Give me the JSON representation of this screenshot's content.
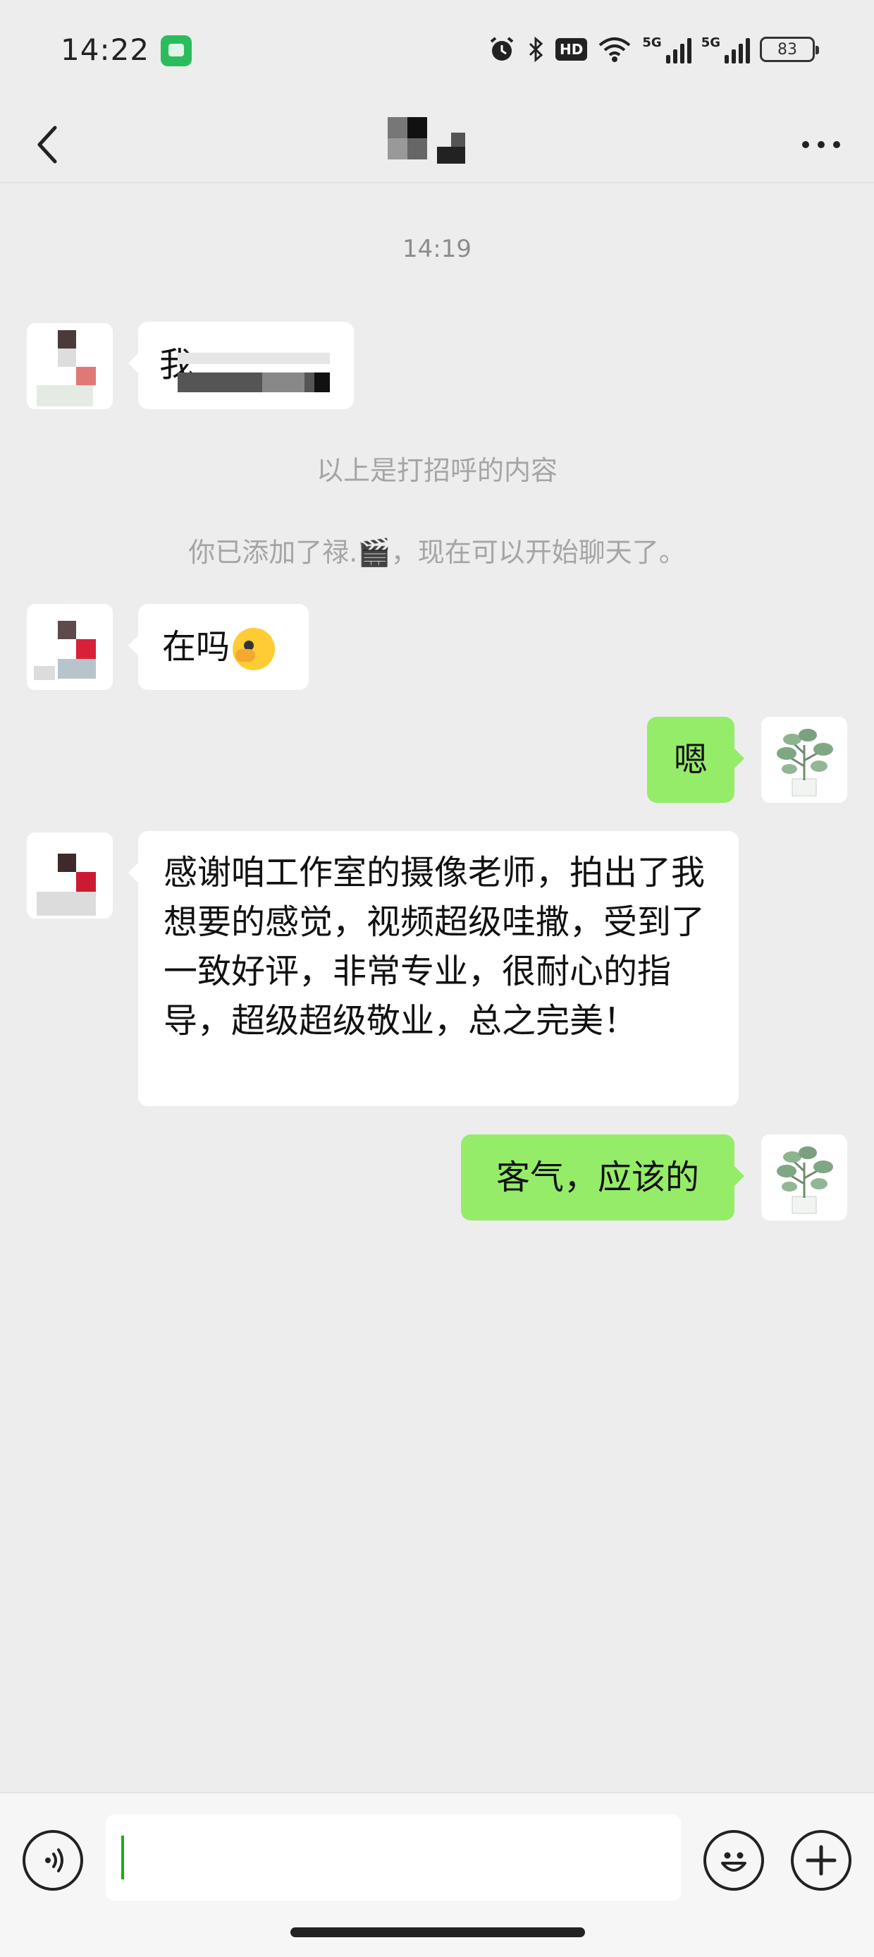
{
  "status_bar": {
    "time": "14:22",
    "notification_icon": "message-app-icon",
    "icons": [
      "alarm-icon",
      "bluetooth-icon",
      "hd-voice-icon",
      "wifi-icon",
      "signal-5g-icon",
      "signal-5g-icon",
      "battery-icon"
    ],
    "hd_label": "HD",
    "network_labels": [
      "5G",
      "5G"
    ],
    "battery": "83"
  },
  "nav": {
    "back_icon": "chevron-left-icon",
    "more_icon": "more-dots-icon"
  },
  "chat": {
    "timestamp": "14:19",
    "greeting_notice": "以上是打招呼的内容",
    "added_notice": "你已添加了禄.🎬，现在可以开始聊天了。",
    "messages": [
      {
        "from": "them",
        "text": "我"
      },
      {
        "from": "them",
        "text": "在吗",
        "emoji": "sly-face-emoji"
      },
      {
        "from": "me",
        "text": "嗯"
      },
      {
        "from": "them",
        "text": "感谢咱工作室的摄像老师，拍出了我想要的感觉，视频超级哇撒，受到了一致好评，非常专业，很耐心的指导，超级超级敬业，总之完美！"
      },
      {
        "from": "me",
        "text": "客气，应该的"
      }
    ]
  },
  "input_bar": {
    "voice_icon": "voice-icon",
    "emoji_icon": "emoji-icon",
    "plus_icon": "plus-icon",
    "value": ""
  },
  "colors": {
    "background": "#ededed",
    "outgoing_bubble": "#95ec69",
    "incoming_bubble": "#ffffff",
    "caret": "#1aad19"
  }
}
